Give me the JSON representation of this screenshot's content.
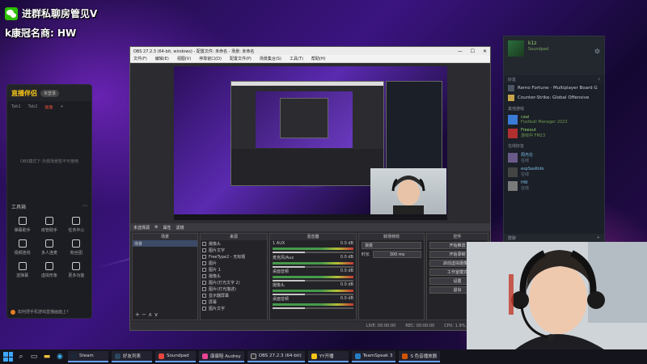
{
  "overlay": {
    "line1": "进群私聊房管见V",
    "line2": "k康冠名商: HW"
  },
  "left_app": {
    "logo": "直播伴侣",
    "badge": "未登录",
    "tabs": [
      "Tab1",
      "Tab2",
      "画面"
    ],
    "active_tab": "画面",
    "empty_text": "OBS模式下 外部场景暂不可使用",
    "tools_title": "工具箱",
    "tools": [
      "弹幕助手",
      "房管助手",
      "任务中心",
      "视频连线",
      "多人连麦",
      "粉丝团",
      "送弹幕",
      "虚拟形象",
      "更多功能"
    ],
    "footer": "如何把手机游戏直播画面上?"
  },
  "obs": {
    "title": "OBS 27.2.3 (64-bit, windows) - 配置文件: 未命名 - 场景: 未命名",
    "menu": [
      "文件(F)",
      "编辑(E)",
      "视图(V)",
      "停靠窗口(D)",
      "配置文件(P)",
      "场景集合(S)",
      "工具(T)",
      "帮助(H)"
    ],
    "toolbar": [
      "未选择源",
      "属性",
      "滤镜"
    ],
    "docks": {
      "scenes": "场景",
      "sources": "来源",
      "mixer": "混音器",
      "transitions": "转场特效",
      "controls": "控件"
    },
    "scene_item": "场景",
    "sources": [
      "摄像头",
      "图片文字",
      "FreeType2 - 无标题",
      "图片",
      "图片 1",
      "摄像头",
      "图片(灯光文字 2)",
      "图片(灯光描述)",
      "显示器屏幕",
      "屏幕",
      "图片文字"
    ],
    "mixer": [
      {
        "name": "1 AUX",
        "db": "0.0 dB"
      },
      {
        "name": "麦克风/Aux",
        "db": "0.0 dB"
      },
      {
        "name": "桌面音频",
        "db": "0.0 dB"
      },
      {
        "name": "摄像头",
        "db": "0.0 dB"
      },
      {
        "name": "桌面音频",
        "db": "0.0 dB"
      }
    ],
    "transition": {
      "type": "渐变",
      "duration_label": "时长",
      "duration": "300 ms"
    },
    "controls": [
      "开始推流",
      "开始录制",
      "启动虚拟摄像机",
      "工作室模式",
      "设置",
      "退出"
    ],
    "status": [
      "LIVE: 00:00:00",
      "REC: 00:00:00",
      "CPU: 1.9%, 30.00 fps"
    ]
  },
  "steam": {
    "user_name": "k1z",
    "user_status": "Soundpad",
    "friends_header": "好友",
    "games": [
      {
        "name": "Remo Fortune - Multiplayer Board G",
        "icon_color": "#4e5a6b"
      },
      {
        "name": "Counter-Strike: Global Offensive",
        "icon_color": "#c7a34a"
      }
    ],
    "section_playing": "其他游戏",
    "friends_playing": [
      {
        "name": "caai",
        "status": "Football Manager 2023"
      },
      {
        "name": "Freeout",
        "status": "游戏中 FM23"
      }
    ],
    "section_online": "在线好友",
    "friends_online": [
      {
        "name": "周杰伦",
        "status": "在线"
      },
      {
        "name": "espSasKido",
        "status": "在线"
      },
      {
        "name": "HW",
        "status": "在线"
      }
    ],
    "footer": "群聊"
  },
  "taskbar": {
    "apps": [
      {
        "label": "Steam",
        "color": "#1b2838"
      },
      {
        "label": "好友列表",
        "color": "#2a475e"
      },
      {
        "label": "Soundpad",
        "color": "#e8453c"
      },
      {
        "label": "康康陪 Audrey",
        "color": "#e84393"
      },
      {
        "label": "OBS 27.2.3 (64-bit)",
        "color": "#302e31"
      },
      {
        "label": "YY开播",
        "color": "#f5c518"
      },
      {
        "label": "TeamSpeak 3",
        "color": "#2580c3"
      },
      {
        "label": "S 色音播放器",
        "color": "#d35400"
      }
    ]
  },
  "colors": {
    "accent": "#e84f3c",
    "steam_online": "#8fd16b",
    "steam_offline": "#7fbde8"
  }
}
